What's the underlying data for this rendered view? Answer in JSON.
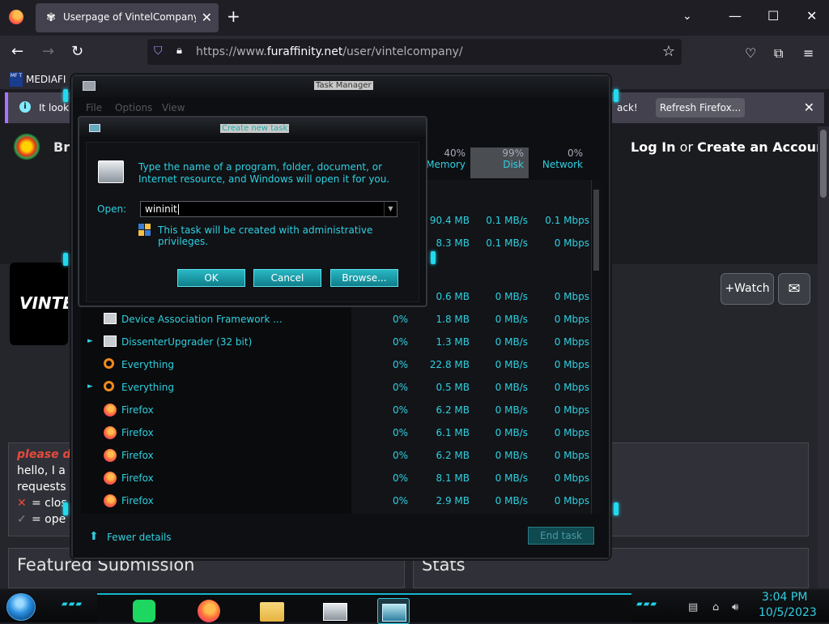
{
  "browser": {
    "tab_title": "Userpage of VintelCompany -- Fur Affinity",
    "new_tab": "+",
    "tab_close": "✕",
    "url_prefix": "https://www.",
    "url_domain": "furaffinity.net",
    "url_path": "/user/vintelcompany/",
    "bookmark_label": "MEDIAFI",
    "bookmark_icon_text": "MF T",
    "notice_text": "It look",
    "notice_tail": "ack!",
    "refresh_label": "Refresh Firefox..."
  },
  "page": {
    "brand_partial": "Br",
    "login": "Log In",
    "or": " or ",
    "create": "Create an Account",
    "avatar_text": "VINTE",
    "watch_label": "+Watch",
    "bio_please": "please d",
    "bio_lines": [
      "hello, I a",
      "requests",
      "= clos",
      "= ope"
    ],
    "featured_title": "Featured Submission",
    "stats_title": "Stats"
  },
  "task_manager": {
    "title": "Task Manager",
    "menu": [
      "File",
      "Options",
      "View"
    ],
    "columns": [
      {
        "pct": "40%",
        "label": "Memory"
      },
      {
        "pct": "99%",
        "label": "Disk"
      },
      {
        "pct": "0%",
        "label": "Network"
      }
    ],
    "partial_rows": [
      {
        "mem": "90.4 MB",
        "disk": "0.1 MB/s",
        "net": "0.1 Mbps"
      },
      {
        "mem": "8.3 MB",
        "disk": "0.1 MB/s",
        "net": "0 Mbps"
      },
      {
        "mem": "0.6 MB",
        "disk": "0 MB/s",
        "net": "0 Mbps"
      }
    ],
    "rows": [
      {
        "name": "Device Association Framework ...",
        "expand": false,
        "icon": "app",
        "cpu": "0%",
        "mem": "1.8 MB",
        "disk": "0 MB/s",
        "net": "0 Mbps"
      },
      {
        "name": "DissenterUpgrader (32 bit)",
        "expand": true,
        "icon": "app",
        "cpu": "0%",
        "mem": "1.3 MB",
        "disk": "0 MB/s",
        "net": "0 Mbps"
      },
      {
        "name": "Everything",
        "expand": false,
        "icon": "search",
        "cpu": "0%",
        "mem": "22.8 MB",
        "disk": "0 MB/s",
        "net": "0 Mbps"
      },
      {
        "name": "Everything",
        "expand": true,
        "icon": "search",
        "cpu": "0%",
        "mem": "0.5 MB",
        "disk": "0 MB/s",
        "net": "0 Mbps"
      },
      {
        "name": "Firefox",
        "expand": false,
        "icon": "fox",
        "cpu": "0%",
        "mem": "6.2 MB",
        "disk": "0 MB/s",
        "net": "0 Mbps"
      },
      {
        "name": "Firefox",
        "expand": false,
        "icon": "fox",
        "cpu": "0%",
        "mem": "6.1 MB",
        "disk": "0 MB/s",
        "net": "0 Mbps"
      },
      {
        "name": "Firefox",
        "expand": false,
        "icon": "fox",
        "cpu": "0%",
        "mem": "6.2 MB",
        "disk": "0 MB/s",
        "net": "0 Mbps"
      },
      {
        "name": "Firefox",
        "expand": false,
        "icon": "fox",
        "cpu": "0%",
        "mem": "8.1 MB",
        "disk": "0 MB/s",
        "net": "0 Mbps"
      },
      {
        "name": "Firefox",
        "expand": false,
        "icon": "fox",
        "cpu": "0%",
        "mem": "2.9 MB",
        "disk": "0 MB/s",
        "net": "0 Mbps"
      }
    ],
    "fewer_details": "Fewer details",
    "end_task": "End task"
  },
  "dialog": {
    "title": "Create new task",
    "message": "Type the name of a program, folder, document, or Internet resource, and Windows will open it for you.",
    "open_label": "Open:",
    "open_value": "wininit",
    "admin_text": "This task will be created with administrative privileges.",
    "ok": "OK",
    "cancel": "Cancel",
    "browse": "Browse..."
  },
  "taskbar": {
    "time": "3:04 PM",
    "date": "10/5/2023"
  },
  "colors": {
    "accent_cyan": "#2fd0e0",
    "firefox_dark": "#1c1b22"
  }
}
